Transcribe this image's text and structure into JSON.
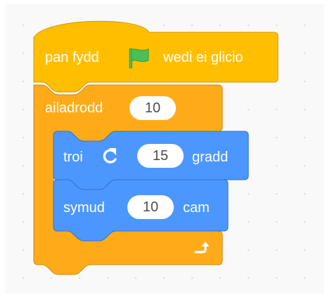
{
  "event_block": {
    "prefix": "pan fydd",
    "icon": "green-flag-icon",
    "suffix": "wedi ei glicio"
  },
  "repeat_block": {
    "label": "ailadrodd",
    "times": "10",
    "loop_icon": "loop-arrow-icon"
  },
  "turn_block": {
    "label": "troi",
    "icon": "rotate-right-icon",
    "degrees": "15",
    "unit": "gradd"
  },
  "move_block": {
    "label": "symud",
    "steps": "10",
    "unit": "cam"
  },
  "colors": {
    "event": "#FFBF00",
    "event_border": "#CC9900",
    "control": "#FFAB19",
    "control_border": "#CF8B17",
    "motion": "#4C97FF",
    "motion_border": "#3373CC",
    "flag_green": "#4CBF56"
  }
}
